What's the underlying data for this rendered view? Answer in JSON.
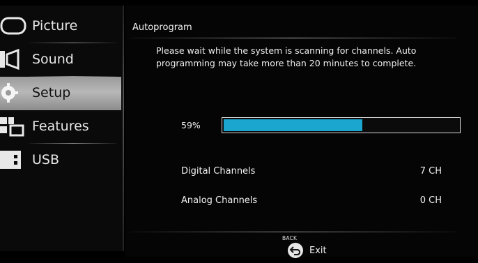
{
  "sidebar": {
    "items": [
      {
        "label": "Picture",
        "icon": "picture-icon",
        "selected": false
      },
      {
        "label": "Sound",
        "icon": "sound-icon",
        "selected": false
      },
      {
        "label": "Setup",
        "icon": "setup-icon",
        "selected": true
      },
      {
        "label": "Features",
        "icon": "features-icon",
        "selected": false
      },
      {
        "label": "USB",
        "icon": "usb-icon",
        "selected": false
      }
    ]
  },
  "main": {
    "title": "Autoprogram",
    "message": "Please wait while the system is scanning for channels. Auto programming may take more than 20 minutes to complete.",
    "progress": {
      "label": "59%",
      "value": 0.59,
      "fill_color": "#1aa6cf"
    },
    "digital": {
      "label": "Digital Channels",
      "value": "7 CH"
    },
    "analog": {
      "label": "Analog Channels",
      "value": "0 CH"
    }
  },
  "footer": {
    "back_hint": "BACK",
    "exit_label": "Exit",
    "back_icon": "return-arrow-icon"
  },
  "colors": {
    "accent": "#1aa6cf",
    "selected_item": "#b0b0b0",
    "background": "#000000"
  }
}
